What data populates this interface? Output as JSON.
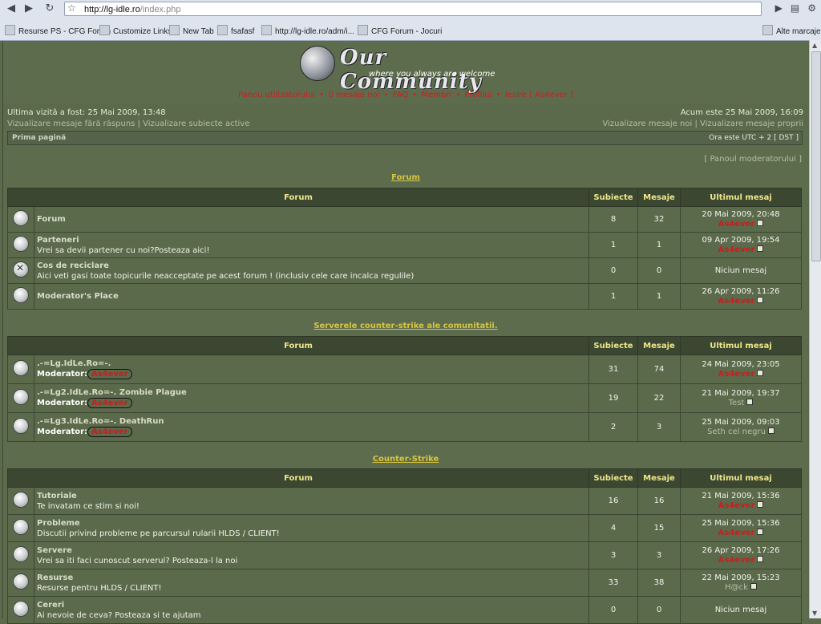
{
  "browser": {
    "url_host": "http://lg-idle.ro",
    "url_path": "/index.php",
    "bookmarks": [
      "Resurse PS - CFG Forum",
      "Customize Links",
      "New Tab",
      "fsafasf",
      "http://lg-idle.ro/adm/i...",
      "CFG Forum - Jocuri"
    ],
    "other_bookmarks": "Alte marcaje"
  },
  "header": {
    "logo_title": "Our Community",
    "logo_tagline": "where you always are welcome",
    "nav": [
      "Panou utilizatorului",
      "0 mesaje noi",
      "FAQ",
      "Membri",
      "Profilul",
      "Iesire [ As4ever ]"
    ]
  },
  "info": {
    "last_visit": "Ultima vizită a fost: 25 Mai 2009, 13:48",
    "unanswered": "Vizualizare mesaje fără răspuns",
    "active": "Vizualizare subiecte active",
    "now": "Acum este 25 Mai 2009, 16:09",
    "new_posts": "Vizualizare mesaje noi",
    "own_posts": "Vizualizare mesaje proprii"
  },
  "breadcrumb": {
    "home": "Prima pagină",
    "tz": "Ora este UTC + 2 [ DST ]"
  },
  "moderator_panel": "Panoul moderatorului",
  "columns": {
    "forum": "Forum",
    "topics": "Subiecte",
    "posts": "Mesaje",
    "last": "Ultimul mesaj"
  },
  "categories": [
    {
      "title": "Forum",
      "forums": [
        {
          "name": "Forum",
          "desc": "",
          "topics": "8",
          "posts": "32",
          "date": "20 Mai 2009, 20:48",
          "author": "As4ever",
          "icon": "read"
        },
        {
          "name": "Parteneri",
          "desc": "Vrei sa devii partener cu noi?Posteaza aici!",
          "topics": "1",
          "posts": "1",
          "date": "09 Apr 2009, 19:54",
          "author": "As4ever",
          "icon": "read"
        },
        {
          "name": "Cos de reciclare",
          "desc": "Aici veti gasi toate topicurile neacceptate pe acest forum ! (inclusiv cele care incalca regulile)",
          "topics": "0",
          "posts": "0",
          "date": "Niciun mesaj",
          "author": "",
          "icon": "locked"
        },
        {
          "name": "Moderator's Place",
          "desc": "",
          "topics": "1",
          "posts": "1",
          "date": "26 Apr 2009, 11:26",
          "author": "As4ever",
          "icon": "read"
        }
      ]
    },
    {
      "title": "Serverele counter-strike ale comunitatii.",
      "forums": [
        {
          "name": ".-=Lg.IdLe.Ro=-.",
          "moderator_label": "Moderator:",
          "moderator": "As4ever",
          "topics": "31",
          "posts": "74",
          "date": "24 Mai 2009, 23:05",
          "author": "As4ever",
          "icon": "read"
        },
        {
          "name": ".-=Lg2.IdLe.Ro=-. Zombie Plague",
          "moderator_label": "Moderator:",
          "moderator": "As4ever",
          "topics": "19",
          "posts": "22",
          "date": "21 Mai 2009, 19:37",
          "author": "Test",
          "icon": "read"
        },
        {
          "name": ".-=Lg3.IdLe.Ro=-. DeathRun",
          "moderator_label": "Moderator:",
          "moderator": "As4ever",
          "topics": "2",
          "posts": "3",
          "date": "25 Mai 2009, 09:03",
          "author": "Seth cel negru",
          "icon": "read"
        }
      ]
    },
    {
      "title": "Counter-Strike",
      "forums": [
        {
          "name": "Tutoriale",
          "desc": "Te invatam ce stim si noi!",
          "topics": "16",
          "posts": "16",
          "date": "21 Mai 2009, 15:36",
          "author": "As4ever",
          "icon": "read"
        },
        {
          "name": "Probleme",
          "desc": "Discutii privind probleme pe parcursul rularii HLDS / CLIENT!",
          "topics": "4",
          "posts": "15",
          "date": "25 Mai 2009, 15:36",
          "author": "As4ever",
          "icon": "read"
        },
        {
          "name": "Servere",
          "desc": "Vrei sa iti faci cunoscut serverul? Posteaza-l la noi",
          "topics": "3",
          "posts": "3",
          "date": "26 Apr 2009, 17:26",
          "author": "As4ever",
          "icon": "read"
        },
        {
          "name": "Resurse",
          "desc": "Resurse pentru HLDS / CLIENT!",
          "topics": "33",
          "posts": "38",
          "date": "22 Mai 2009, 15:23",
          "author": "H@ck",
          "icon": "read"
        },
        {
          "name": "Cereri",
          "desc": "Ai nevoie de ceva? Posteaza si te ajutam",
          "topics": "0",
          "posts": "0",
          "date": "Niciun mesaj",
          "author": "",
          "icon": "read"
        }
      ]
    }
  ]
}
